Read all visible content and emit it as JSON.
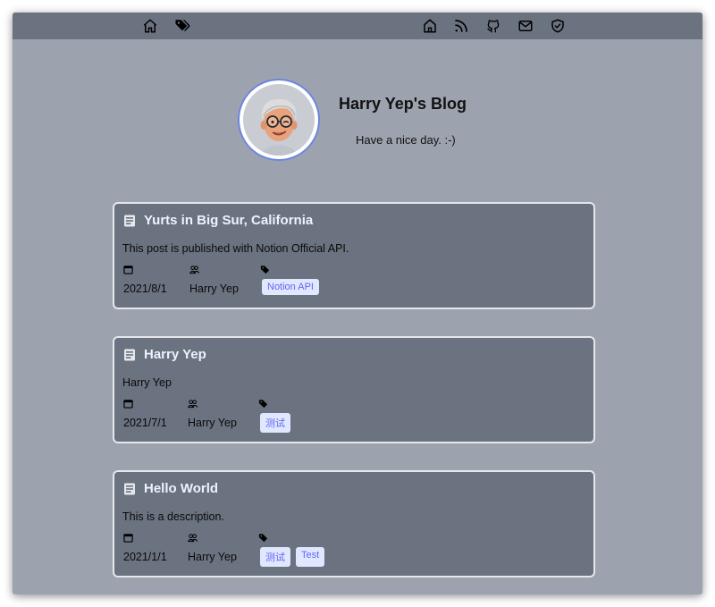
{
  "nav": {
    "left": [
      {
        "name": "home-icon"
      },
      {
        "name": "tags-icon"
      }
    ],
    "right": [
      {
        "name": "home-outline-icon"
      },
      {
        "name": "rss-icon"
      },
      {
        "name": "github-icon"
      },
      {
        "name": "mail-icon"
      },
      {
        "name": "shield-check-icon"
      }
    ]
  },
  "profile": {
    "title": "Harry Yep's Blog",
    "subtitle": "Have a nice day. :-)",
    "avatar_icon": "memoji-avatar"
  },
  "posts": [
    {
      "title": "Yurts in Big Sur, California",
      "description": "This post is published with Notion Official API.",
      "date": "2021/8/1",
      "author": "Harry Yep",
      "tags": [
        "Notion API"
      ]
    },
    {
      "title": "Harry Yep",
      "description": "Harry Yep",
      "date": "2021/7/1",
      "author": "Harry Yep",
      "tags": [
        "测试"
      ]
    },
    {
      "title": "Hello World",
      "description": "This is a description.",
      "date": "2021/1/1",
      "author": "Harry Yep",
      "tags": [
        "测试",
        "Test"
      ]
    }
  ],
  "colors": {
    "background": "#9ca3af",
    "navbar": "#6b7280",
    "card": "#6b7280",
    "tag_bg": "#e0e7ff",
    "tag_text": "#6366f1",
    "avatar_ring": "#6b86e0"
  }
}
